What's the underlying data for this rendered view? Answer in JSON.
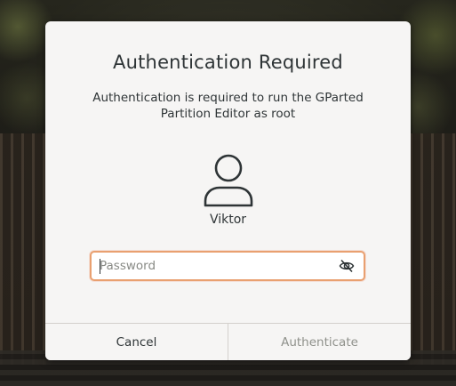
{
  "dialog": {
    "title": "Authentication Required",
    "message": "Authentication is required to run the GParted Partition Editor as root",
    "username": "Viktor",
    "avatar_icon": "user-icon",
    "password": {
      "value": "",
      "placeholder": "Password",
      "reveal_icon": "eye-hidden-icon"
    },
    "buttons": {
      "cancel_label": "Cancel",
      "authenticate_label": "Authenticate"
    }
  },
  "colors": {
    "dialog_bg": "#f6f5f4",
    "text": "#2e3436",
    "focus_border": "#e9a070",
    "disabled_text": "#8f918b"
  }
}
